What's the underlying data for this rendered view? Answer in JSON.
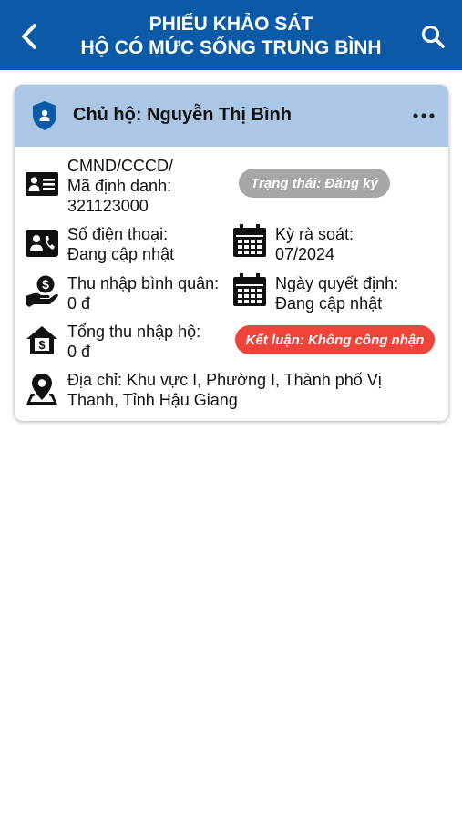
{
  "header": {
    "title_line1": "PHIẾU KHẢO SÁT",
    "title_line2": "HỘ CÓ MỨC SỐNG TRUNG BÌNH",
    "back_icon": "chevron-left-icon",
    "search_icon": "search-icon",
    "background": "#0a5aa8"
  },
  "card": {
    "owner_label": "Chủ hộ: Nguyễn Thị Bình",
    "id_label_line1": "CMND/CCCD/",
    "id_label_line2": "Mã định danh:",
    "id_value": "321123000",
    "status_badge": "Trạng thái: Đăng ký",
    "phone_label": "Số điện thoại:",
    "phone_value": "Đang cập nhật",
    "review_label": "Kỳ rà soát:",
    "review_value": "07/2024",
    "avg_income_label": "Thu nhập bình quân:",
    "avg_income_value": "0 đ",
    "decision_label": "Ngày quyết định:",
    "decision_value": "Đang cập nhật",
    "total_income_label": "Tổng thu nhập hộ:",
    "total_income_value": "0 đ",
    "conclusion_badge": "Kết luận: Không công nhận",
    "address_line1": "Địa chỉ: Khu vực I, Phường I, Thành phố Vị",
    "address_line2": "Thanh, Tỉnh Hậu Giang",
    "colors": {
      "header_band": "#aac8e6",
      "shield": "#0a5aa8",
      "status_badge": "#a7a7a7",
      "conclusion_badge": "#f0433a"
    }
  }
}
